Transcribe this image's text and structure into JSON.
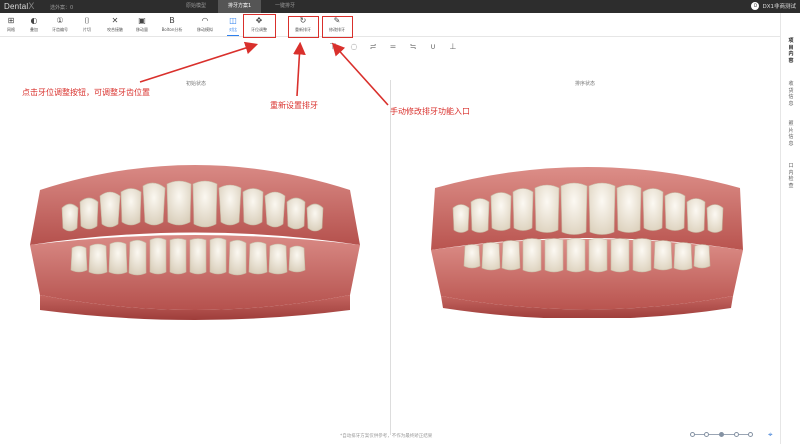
{
  "header": {
    "logo_text": "Dental",
    "logo_mark": "X",
    "patient_label": "选外案",
    "patient_count": "0",
    "tabs": [
      {
        "label": "原始模型",
        "active": false
      },
      {
        "label": "排牙方案1",
        "active": true
      },
      {
        "label": "一键排牙",
        "active": false
      }
    ],
    "user_badge": "D",
    "user_name": "DX1非商测试"
  },
  "toolbar": {
    "items": [
      {
        "label": "网格",
        "icon": "grid-icon"
      },
      {
        "label": "叠加",
        "icon": "overlay-icon"
      },
      {
        "label": "牙齿编号",
        "icon": "tooth-number-icon"
      },
      {
        "label": "片切",
        "icon": "ipr-icon"
      },
      {
        "label": "咬合接触",
        "icon": "occlusal-contact-icon"
      },
      {
        "label": "移动量",
        "icon": "movement-icon"
      },
      {
        "label": "Bolton分析",
        "icon": "bolton-icon"
      },
      {
        "label": "移动模拟",
        "icon": "simulation-gauge-icon"
      },
      {
        "label": "对比",
        "icon": "compare-icon",
        "active": true
      },
      {
        "label": "牙位调整",
        "icon": "move-arrows-icon"
      },
      {
        "label": "重新排牙",
        "icon": "refresh-icon"
      },
      {
        "label": "修改排牙",
        "icon": "edit-icon"
      }
    ]
  },
  "sidebar": {
    "items": [
      {
        "label": "项目内容",
        "active": true
      },
      {
        "label": "收货信息",
        "active": false
      },
      {
        "label": "照片信息",
        "active": false
      },
      {
        "label": "口内检查",
        "active": false
      }
    ]
  },
  "viewports": {
    "left_label": "初始状态",
    "right_label": "排序状态"
  },
  "annotations": {
    "adjust": "点击牙位调整按钮，可调整牙齿位置",
    "reset": "重新设置排牙",
    "manual": "手动修改排牙功能入口"
  },
  "footer_note": "*自动排牙方案仅供参考，不作为最终矫正结果",
  "colors": {
    "annotation": "#d9302c",
    "accent": "#2f80ed",
    "gum": "#c9625f",
    "tooth": "#f4ede0"
  }
}
